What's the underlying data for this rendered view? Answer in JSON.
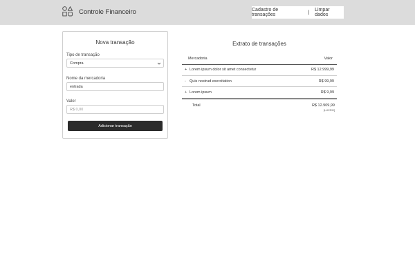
{
  "header": {
    "logo_icon": "shapes-icon",
    "app_title": "Controle Financeiro",
    "nav": {
      "cadastro_label": "Cadastro de transações",
      "separator": "|",
      "limpar_label": "Limpar dados"
    }
  },
  "form": {
    "title": "Nova transação",
    "tipo_label": "Tipo de transação",
    "tipo_value": "Compra",
    "nome_label": "Nome da mercadoria",
    "nome_value": "entrada",
    "valor_label": "Valor",
    "valor_placeholder": "R$ 0,00",
    "submit_label": "Adicionar transação"
  },
  "statement": {
    "title": "Extrato de transações",
    "columns": [
      "Mercadoria",
      "Valor"
    ],
    "rows": [
      {
        "sign": "+",
        "name": "Lorem ipsum dolor sit amet consectetur",
        "value": "R$ 12.999,99"
      },
      {
        "sign": "-",
        "name": "Quis nostrud exercitation",
        "value": "R$ 99,99"
      },
      {
        "sign": "+",
        "name": "Lorem ipsum",
        "value": "R$ 9,99"
      }
    ],
    "total_label": "Total",
    "total_value": "R$ 12.909,99",
    "total_status": "[LUCRO]"
  },
  "colors": {
    "header_bg": "#dcdcdc",
    "button_bg": "#2b2b2b"
  }
}
